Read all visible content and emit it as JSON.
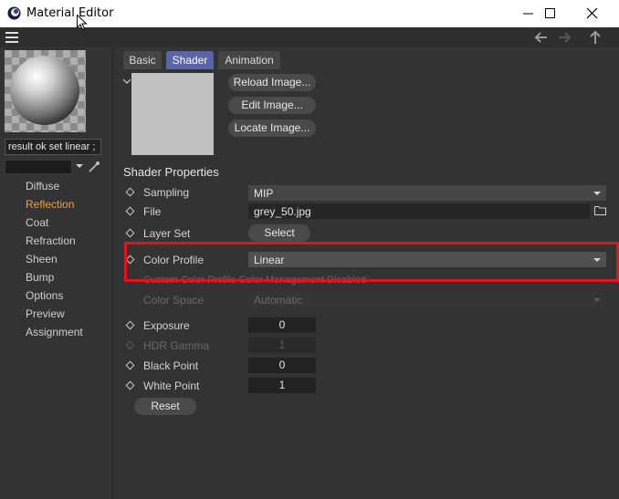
{
  "window": {
    "title": "Material Editor",
    "controls": [
      "minimize-icon",
      "maximize-icon",
      "close-icon"
    ]
  },
  "toolbar": {
    "icons": [
      "menu-icon",
      "back-arrow-icon",
      "forward-arrow-icon",
      "up-arrow-icon"
    ]
  },
  "material": {
    "name": "result ok  set linear ;"
  },
  "channels": [
    {
      "label": "Diffuse",
      "active": false
    },
    {
      "label": "Reflection",
      "active": true
    },
    {
      "label": "Coat",
      "active": false
    },
    {
      "label": "Refraction",
      "active": false
    },
    {
      "label": "Sheen",
      "active": false
    },
    {
      "label": "Bump",
      "active": false
    },
    {
      "label": "Options",
      "active": false
    },
    {
      "label": "Preview",
      "active": false
    },
    {
      "label": "Assignment",
      "active": false
    }
  ],
  "tabs": [
    {
      "label": "Basic",
      "active": false
    },
    {
      "label": "Shader",
      "active": true
    },
    {
      "label": "Animation",
      "active": false
    }
  ],
  "image_buttons": {
    "reload": "Reload Image...",
    "edit": "Edit Image...",
    "locate": "Locate Image..."
  },
  "shader_properties": {
    "title": "Shader Properties",
    "sampling": {
      "label": "Sampling",
      "value": "MIP"
    },
    "file": {
      "label": "File",
      "value": "grey_50.jpg"
    },
    "layer_set": {
      "label": "Layer Set",
      "button": "Select"
    },
    "color_profile": {
      "label": "Color Profile",
      "value": "Linear"
    },
    "hidden_row": "Custom Color Profile   Color Management Disabled",
    "color_space": {
      "label": "Color Space",
      "value": "Automatic"
    },
    "exposure": {
      "label": "Exposure",
      "value": "0"
    },
    "hdr_gamma": {
      "label": "HDR Gamma",
      "value": "1"
    },
    "black_point": {
      "label": "Black Point",
      "value": "0"
    },
    "white_point": {
      "label": "White Point",
      "value": "1"
    },
    "reset": "Reset"
  },
  "colors": {
    "accent_active_tab": "#5a64a6",
    "active_channel": "#f0a23c",
    "highlight_box": "#e1141c",
    "panel_bg": "#333333"
  }
}
